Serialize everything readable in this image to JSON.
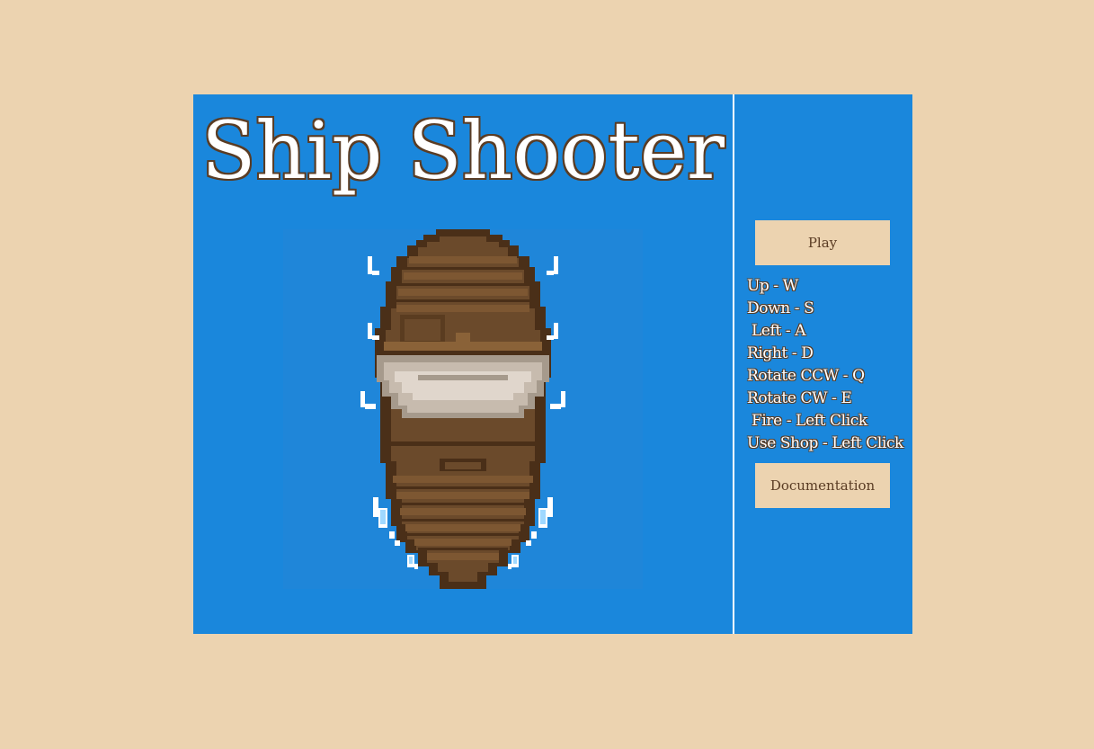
{
  "game": {
    "title": "Ship Shooter"
  },
  "menu": {
    "play_label": "Play",
    "documentation_label": "Documentation"
  },
  "controls": [
    "Up - W",
    "Down - S",
    " Left - A",
    "Right - D",
    "Rotate CCW - Q",
    "Rotate CW - E",
    " Fire - Left Click",
    "Use Shop - Left Click"
  ],
  "colors": {
    "page_background": "#ecd3b0",
    "game_background": "#1a87dc",
    "button_background": "#ecd3b0",
    "text_outline": "#5a3c24",
    "hull_dark": "#4a2f18",
    "hull_mid": "#6b4a2b",
    "hull_light": "#7d5732",
    "sail": "#d8ccc0",
    "water_spray": "#ffffff"
  },
  "icons": [
    "ship-sprite",
    "water-splash-icon"
  ]
}
